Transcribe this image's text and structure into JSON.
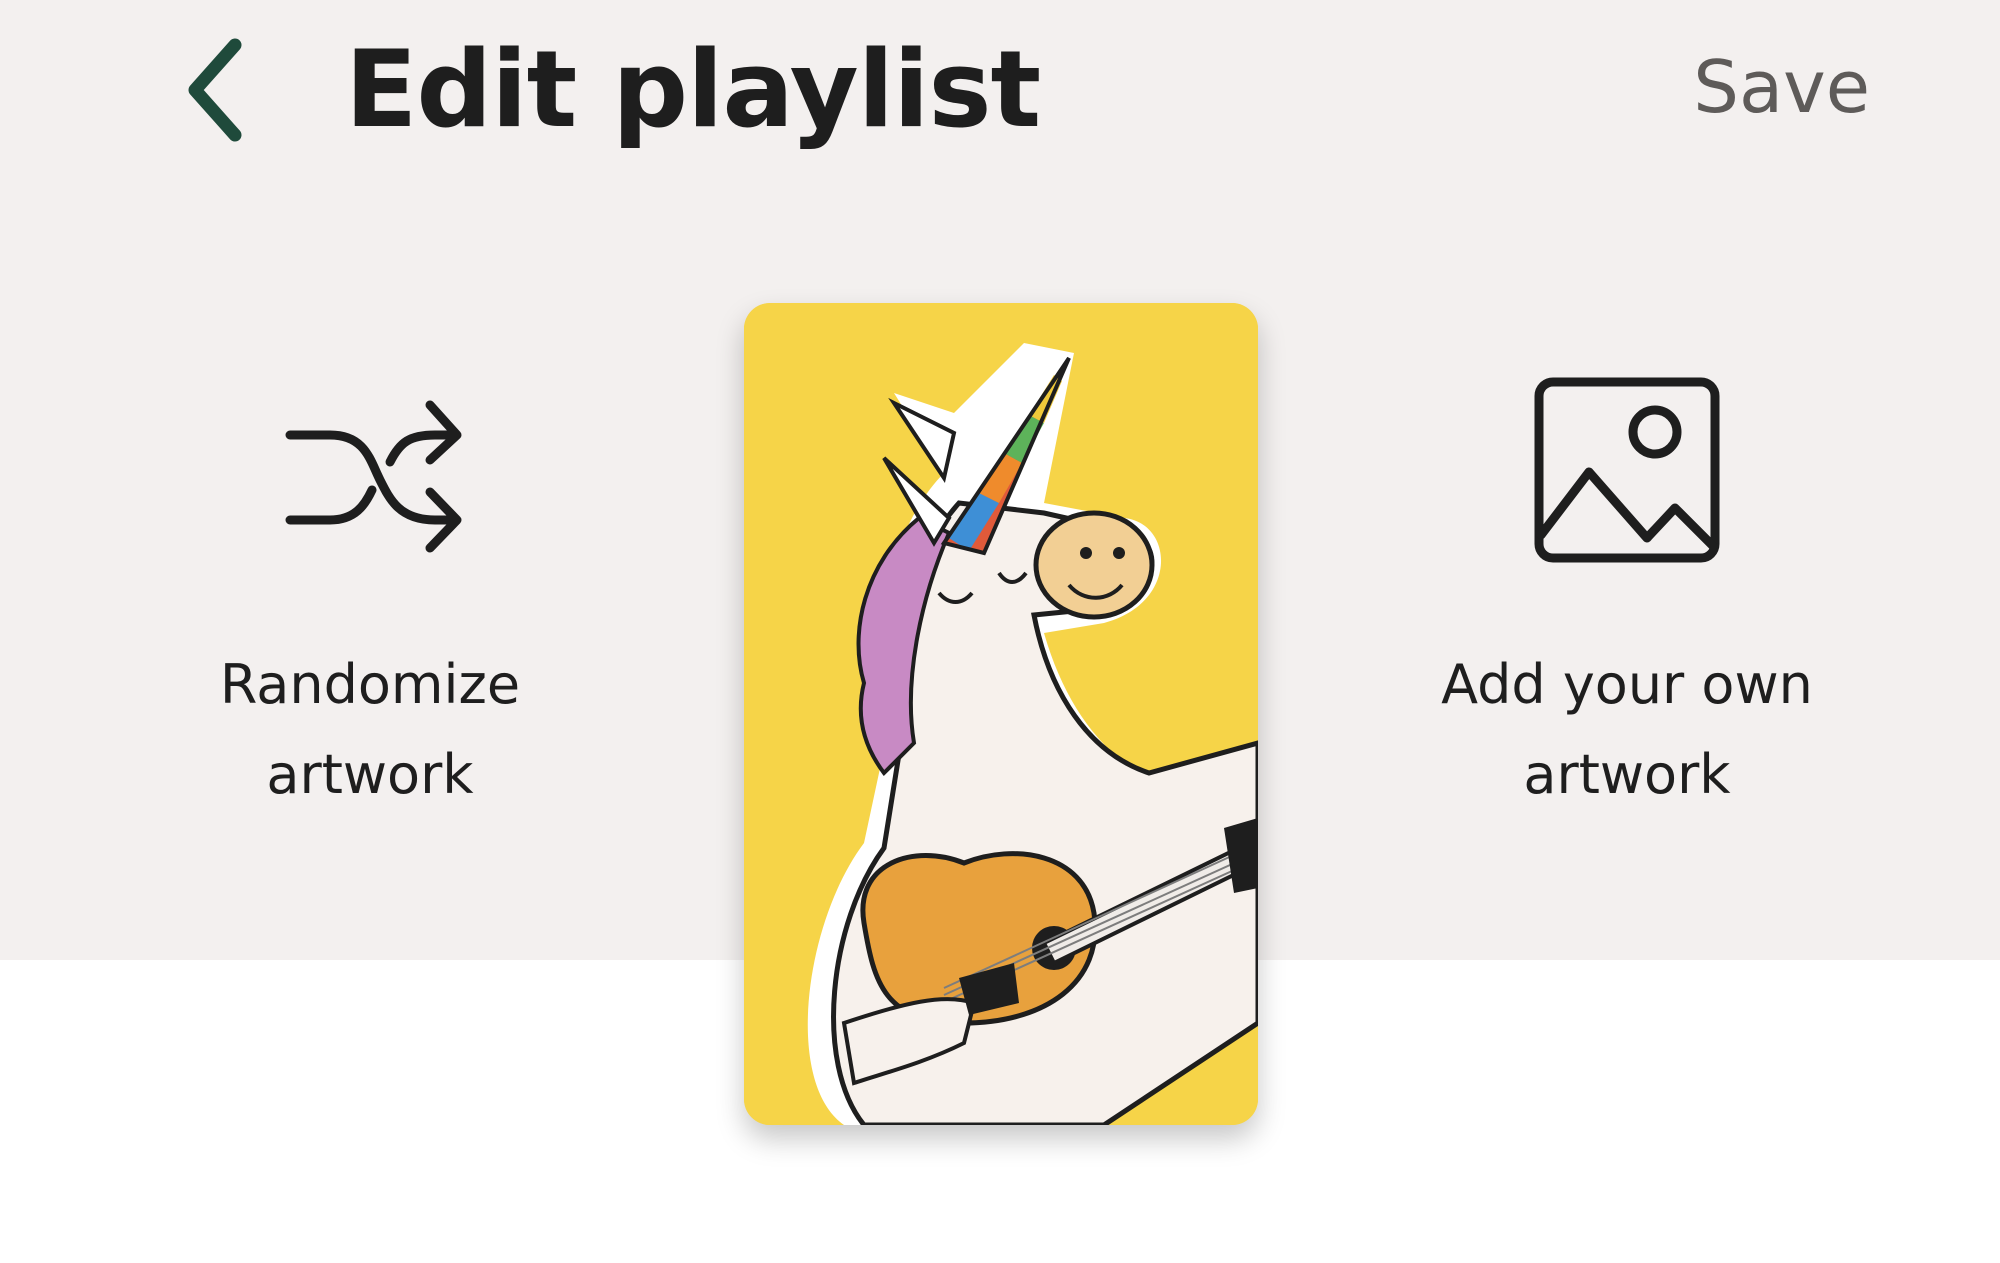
{
  "header": {
    "back_icon": "chevron-left-icon",
    "title": "Edit playlist",
    "save_label": "Save"
  },
  "options": {
    "randomize": {
      "icon": "shuffle-icon",
      "line1": "Randomize",
      "line2": "artwork"
    },
    "own": {
      "icon": "image-icon",
      "line1": "Add your own",
      "line2": "artwork"
    }
  },
  "artwork": {
    "illustration": "unicorn-playing-ukulele",
    "background_color": "#f6d448"
  },
  "colors": {
    "header_background": "#f3f0ef",
    "back_arrow": "#1f4a3b",
    "title_text": "#1e1e1e",
    "save_text": "#5e5b59"
  }
}
